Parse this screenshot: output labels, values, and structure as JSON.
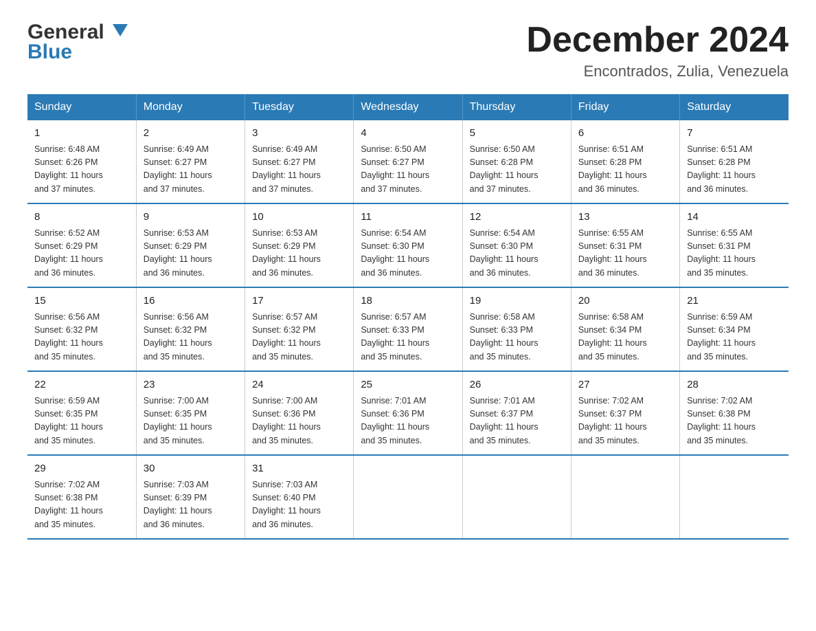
{
  "logo": {
    "line1": "General",
    "line2": "Blue"
  },
  "header": {
    "month": "December 2024",
    "location": "Encontrados, Zulia, Venezuela"
  },
  "days_of_week": [
    "Sunday",
    "Monday",
    "Tuesday",
    "Wednesday",
    "Thursday",
    "Friday",
    "Saturday"
  ],
  "weeks": [
    [
      {
        "day": "1",
        "sunrise": "6:48 AM",
        "sunset": "6:26 PM",
        "daylight": "11 hours and 37 minutes."
      },
      {
        "day": "2",
        "sunrise": "6:49 AM",
        "sunset": "6:27 PM",
        "daylight": "11 hours and 37 minutes."
      },
      {
        "day": "3",
        "sunrise": "6:49 AM",
        "sunset": "6:27 PM",
        "daylight": "11 hours and 37 minutes."
      },
      {
        "day": "4",
        "sunrise": "6:50 AM",
        "sunset": "6:27 PM",
        "daylight": "11 hours and 37 minutes."
      },
      {
        "day": "5",
        "sunrise": "6:50 AM",
        "sunset": "6:28 PM",
        "daylight": "11 hours and 37 minutes."
      },
      {
        "day": "6",
        "sunrise": "6:51 AM",
        "sunset": "6:28 PM",
        "daylight": "11 hours and 36 minutes."
      },
      {
        "day": "7",
        "sunrise": "6:51 AM",
        "sunset": "6:28 PM",
        "daylight": "11 hours and 36 minutes."
      }
    ],
    [
      {
        "day": "8",
        "sunrise": "6:52 AM",
        "sunset": "6:29 PM",
        "daylight": "11 hours and 36 minutes."
      },
      {
        "day": "9",
        "sunrise": "6:53 AM",
        "sunset": "6:29 PM",
        "daylight": "11 hours and 36 minutes."
      },
      {
        "day": "10",
        "sunrise": "6:53 AM",
        "sunset": "6:29 PM",
        "daylight": "11 hours and 36 minutes."
      },
      {
        "day": "11",
        "sunrise": "6:54 AM",
        "sunset": "6:30 PM",
        "daylight": "11 hours and 36 minutes."
      },
      {
        "day": "12",
        "sunrise": "6:54 AM",
        "sunset": "6:30 PM",
        "daylight": "11 hours and 36 minutes."
      },
      {
        "day": "13",
        "sunrise": "6:55 AM",
        "sunset": "6:31 PM",
        "daylight": "11 hours and 36 minutes."
      },
      {
        "day": "14",
        "sunrise": "6:55 AM",
        "sunset": "6:31 PM",
        "daylight": "11 hours and 35 minutes."
      }
    ],
    [
      {
        "day": "15",
        "sunrise": "6:56 AM",
        "sunset": "6:32 PM",
        "daylight": "11 hours and 35 minutes."
      },
      {
        "day": "16",
        "sunrise": "6:56 AM",
        "sunset": "6:32 PM",
        "daylight": "11 hours and 35 minutes."
      },
      {
        "day": "17",
        "sunrise": "6:57 AM",
        "sunset": "6:32 PM",
        "daylight": "11 hours and 35 minutes."
      },
      {
        "day": "18",
        "sunrise": "6:57 AM",
        "sunset": "6:33 PM",
        "daylight": "11 hours and 35 minutes."
      },
      {
        "day": "19",
        "sunrise": "6:58 AM",
        "sunset": "6:33 PM",
        "daylight": "11 hours and 35 minutes."
      },
      {
        "day": "20",
        "sunrise": "6:58 AM",
        "sunset": "6:34 PM",
        "daylight": "11 hours and 35 minutes."
      },
      {
        "day": "21",
        "sunrise": "6:59 AM",
        "sunset": "6:34 PM",
        "daylight": "11 hours and 35 minutes."
      }
    ],
    [
      {
        "day": "22",
        "sunrise": "6:59 AM",
        "sunset": "6:35 PM",
        "daylight": "11 hours and 35 minutes."
      },
      {
        "day": "23",
        "sunrise": "7:00 AM",
        "sunset": "6:35 PM",
        "daylight": "11 hours and 35 minutes."
      },
      {
        "day": "24",
        "sunrise": "7:00 AM",
        "sunset": "6:36 PM",
        "daylight": "11 hours and 35 minutes."
      },
      {
        "day": "25",
        "sunrise": "7:01 AM",
        "sunset": "6:36 PM",
        "daylight": "11 hours and 35 minutes."
      },
      {
        "day": "26",
        "sunrise": "7:01 AM",
        "sunset": "6:37 PM",
        "daylight": "11 hours and 35 minutes."
      },
      {
        "day": "27",
        "sunrise": "7:02 AM",
        "sunset": "6:37 PM",
        "daylight": "11 hours and 35 minutes."
      },
      {
        "day": "28",
        "sunrise": "7:02 AM",
        "sunset": "6:38 PM",
        "daylight": "11 hours and 35 minutes."
      }
    ],
    [
      {
        "day": "29",
        "sunrise": "7:02 AM",
        "sunset": "6:38 PM",
        "daylight": "11 hours and 35 minutes."
      },
      {
        "day": "30",
        "sunrise": "7:03 AM",
        "sunset": "6:39 PM",
        "daylight": "11 hours and 36 minutes."
      },
      {
        "day": "31",
        "sunrise": "7:03 AM",
        "sunset": "6:40 PM",
        "daylight": "11 hours and 36 minutes."
      },
      null,
      null,
      null,
      null
    ]
  ],
  "labels": {
    "sunrise": "Sunrise:",
    "sunset": "Sunset:",
    "daylight": "Daylight:"
  }
}
